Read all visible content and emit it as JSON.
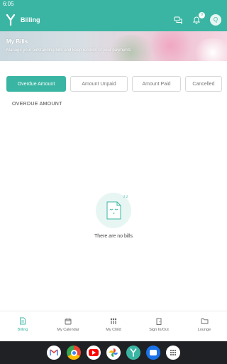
{
  "status_bar": {
    "time": "6:05"
  },
  "app_bar": {
    "title": "Billing",
    "notification_count": "0",
    "avatar_initial": "Q",
    "icons": [
      "app-logo",
      "chat-icon",
      "bell-icon"
    ]
  },
  "banner": {
    "title": "My Bills",
    "subtitle": "Manage your outstanding bills and keep records of your payments"
  },
  "tabs": [
    {
      "label": "Overdue Amount",
      "active": true
    },
    {
      "label": "Amount Unpaid",
      "active": false
    },
    {
      "label": "Amount Paid",
      "active": false
    },
    {
      "label": "Cancelled",
      "active": false
    }
  ],
  "section": {
    "heading": "OVERDUE AMOUNT"
  },
  "empty_state": {
    "message": "There are no bills",
    "sleep_text": "z z"
  },
  "bottom_nav": [
    {
      "label": "Billing",
      "icon": "document-icon",
      "active": true
    },
    {
      "label": "My Calendar",
      "icon": "calendar-icon",
      "active": false
    },
    {
      "label": "My Child",
      "icon": "children-icon",
      "active": false
    },
    {
      "label": "Sign In/Out",
      "icon": "door-icon",
      "active": false
    },
    {
      "label": "Lounge",
      "icon": "folder-icon",
      "active": false
    }
  ],
  "colors": {
    "accent": "#3bb5a3",
    "system_bar": "#202124"
  }
}
